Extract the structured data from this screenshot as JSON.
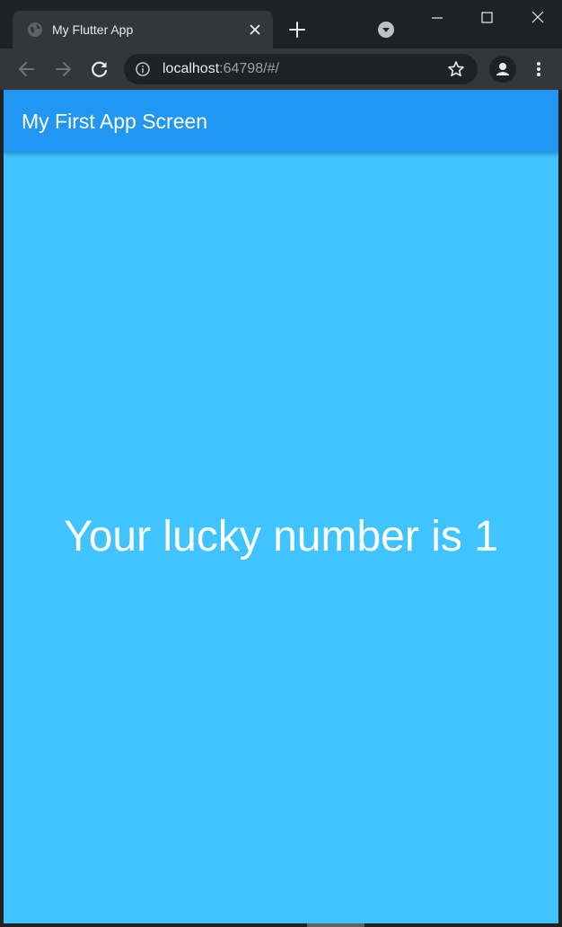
{
  "browser": {
    "tab": {
      "title": "My Flutter App",
      "favicon": "globe-icon"
    },
    "url": {
      "host": "localhost",
      "rest": ":64798/#/"
    },
    "icons": {
      "back": "arrow-left-icon",
      "forward": "arrow-right-icon",
      "reload": "reload-icon",
      "info": "info-icon",
      "bookmark": "star-icon",
      "profile": "person-icon",
      "menu": "kebab-menu-icon",
      "new_tab": "plus-icon",
      "tab_search": "chevron-down-icon",
      "minimize": "minimize-icon",
      "maximize": "maximize-icon",
      "close": "close-icon"
    },
    "colors": {
      "frame": "#202124",
      "toolbar": "#35363a",
      "text": "#e8eaed",
      "muted": "#9aa0a6"
    }
  },
  "app": {
    "appbar": {
      "title": "My First App Screen"
    },
    "body": {
      "message": "Your lucky number is 1"
    },
    "colors": {
      "appbar": "#2196f3",
      "background": "#40c4ff",
      "text": "#ffffff"
    }
  }
}
